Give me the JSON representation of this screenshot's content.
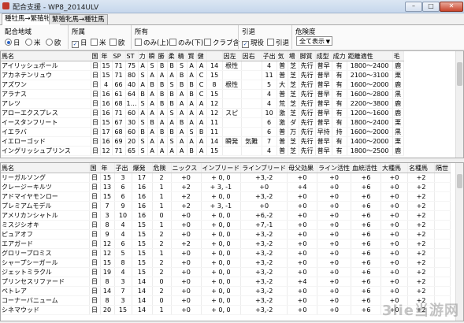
{
  "window": {
    "title": "配合支援 - WP8_2014ULV"
  },
  "tabs": [
    "種牡馬→繁殖牝馬",
    "繁殖牝馬→種牡馬"
  ],
  "filters": {
    "region": {
      "label": "配合地域",
      "options": [
        "日",
        "米",
        "欧"
      ],
      "selected": 0
    },
    "affiliation": {
      "label": "所属",
      "options": [
        "日",
        "米",
        "欧"
      ],
      "checked": [
        true,
        false,
        false
      ]
    },
    "owned": {
      "label": "所有",
      "options": [
        "のみ(上)",
        "のみ(下)",
        "クラブ含"
      ]
    },
    "retired": {
      "label": "引退",
      "options": [
        "現役",
        "引退"
      ],
      "checked": [
        true,
        false
      ]
    },
    "risk": {
      "label": "危険度",
      "value": "全て表示"
    }
  },
  "top_table": {
    "headers": [
      "馬名",
      "国",
      "年",
      "SP",
      "ST",
      "力",
      "瞬",
      "勝",
      "柔",
      "精",
      "賢",
      "健",
      "",
      "因左",
      "因右",
      "子出",
      "気",
      "場",
      "脚質",
      "成型",
      "成力",
      "距離適性",
      "毛"
    ],
    "rows": [
      [
        "アイリッシュボール",
        "日",
        "15",
        "71",
        "75",
        "A",
        "S",
        "B",
        "B",
        "S",
        "A",
        "A",
        "14",
        "根性",
        "",
        "4",
        "普",
        "芝",
        "先行",
        "普早",
        "有",
        "1800〜2400",
        "鹿"
      ],
      [
        "アカネテンリュウ",
        "日",
        "15",
        "71",
        "80",
        "S",
        "A",
        "A",
        "A",
        "B",
        "A",
        "C",
        "15",
        "",
        "",
        "11",
        "普",
        "芝",
        "先行",
        "普早",
        "有",
        "2100〜3100",
        "栗"
      ],
      [
        "アズワン",
        "日",
        "4",
        "66",
        "40",
        "A",
        "B",
        "B",
        "S",
        "B",
        "B",
        "C",
        "8",
        "根性",
        "",
        "5",
        "大",
        "芝",
        "先行",
        "普早",
        "有",
        "1600〜2000",
        "鹿"
      ],
      [
        "アラナス",
        "日",
        "16",
        "61",
        "64",
        "B",
        "A",
        "B",
        "B",
        "A",
        "B",
        "C",
        "15",
        "",
        "",
        "4",
        "普",
        "芝",
        "先行",
        "普早",
        "有",
        "1600〜2800",
        "黒"
      ],
      [
        "アレツ",
        "日",
        "16",
        "68",
        "1…",
        "S",
        "A",
        "B",
        "B",
        "A",
        "A",
        "A",
        "12",
        "",
        "",
        "4",
        "荒",
        "芝",
        "先行",
        "普早",
        "有",
        "2200〜3800",
        "鹿"
      ],
      [
        "アローエクスプレス",
        "日",
        "16",
        "71",
        "60",
        "A",
        "A",
        "A",
        "S",
        "A",
        "A",
        "A",
        "12",
        "スピ",
        "",
        "10",
        "激",
        "芝",
        "先行",
        "普早",
        "有",
        "1200〜1600",
        "鹿"
      ],
      [
        "イースタンフリート",
        "日",
        "15",
        "67",
        "30",
        "S",
        "B",
        "A",
        "A",
        "B",
        "A",
        "A",
        "11",
        "",
        "",
        "6",
        "激",
        "ダ",
        "先行",
        "普早",
        "有",
        "1800〜2400",
        "栗"
      ],
      [
        "イエラバ",
        "日",
        "17",
        "68",
        "60",
        "B",
        "A",
        "B",
        "B",
        "A",
        "S",
        "B",
        "11",
        "",
        "",
        "6",
        "普",
        "万",
        "先行",
        "早持",
        "持",
        "1600〜2000",
        "黒"
      ],
      [
        "イエローゴッド",
        "日",
        "16",
        "69",
        "20",
        "S",
        "A",
        "A",
        "S",
        "A",
        "A",
        "A",
        "14",
        "瞬発",
        "気難",
        "7",
        "普",
        "芝",
        "先行",
        "普早",
        "有",
        "1400〜2000",
        "栗"
      ],
      [
        "イングリッシュプリンス",
        "日",
        "12",
        "71",
        "65",
        "S",
        "A",
        "A",
        "A",
        "A",
        "B",
        "A",
        "15",
        "",
        "",
        "4",
        "普",
        "芝",
        "先行",
        "普早",
        "有",
        "1800〜2500",
        "鹿"
      ]
    ]
  },
  "bottom_table": {
    "headers": [
      "馬名",
      "国",
      "年",
      "子出",
      "爆発",
      "危険",
      "ニックス",
      "インブリード",
      "ラインブリード",
      "母父効果",
      "ライン活性",
      "血統活性",
      "大種馬",
      "名種馬",
      "隔世"
    ],
    "rows": [
      [
        "リーガルソング",
        "日",
        "15",
        "3",
        "17",
        "2",
        "+0",
        "+ 0, 0",
        "+3,-2",
        "+0",
        "+0",
        "+6",
        "+0",
        "+2",
        ""
      ],
      [
        "クレージーキルツ",
        "日",
        "13",
        "6",
        "16",
        "1",
        "+2",
        "+ 3, -1",
        "+0",
        "+4",
        "+0",
        "+6",
        "+0",
        "+2",
        ""
      ],
      [
        "アドマイヤモンロー",
        "日",
        "15",
        "6",
        "16",
        "1",
        "+2",
        "+ 0, 0",
        "+3,-2",
        "+0",
        "+0",
        "+6",
        "+0",
        "+2",
        ""
      ],
      [
        "プレミアムモデル",
        "日",
        "7",
        "9",
        "16",
        "1",
        "+2",
        "+ 3, -1",
        "+0",
        "+0",
        "+0",
        "+6",
        "+0",
        "+2",
        ""
      ],
      [
        "アメリカンシャトル",
        "日",
        "3",
        "10",
        "16",
        "0",
        "+0",
        "+ 0, 0",
        "+6,-2",
        "+0",
        "+0",
        "+6",
        "+0",
        "+2",
        ""
      ],
      [
        "ミスジシオキ",
        "日",
        "8",
        "4",
        "15",
        "1",
        "+0",
        "+ 0, 0",
        "+7,-1",
        "+0",
        "+0",
        "+6",
        "+0",
        "+2",
        ""
      ],
      [
        "ピュアオフ",
        "日",
        "9",
        "4",
        "15",
        "2",
        "+0",
        "+ 0, 0",
        "+3,-2",
        "+0",
        "+0",
        "+6",
        "+0",
        "+2",
        ""
      ],
      [
        "エアガード",
        "日",
        "12",
        "6",
        "15",
        "2",
        "+2",
        "+ 0, 0",
        "+3,-2",
        "+0",
        "+0",
        "+6",
        "+0",
        "+2",
        ""
      ],
      [
        "グロリープロミス",
        "日",
        "12",
        "5",
        "15",
        "1",
        "+0",
        "+ 0, 0",
        "+3,-2",
        "+0",
        "+0",
        "+6",
        "+0",
        "+2",
        ""
      ],
      [
        "シャープシーガール",
        "日",
        "15",
        "8",
        "15",
        "2",
        "+0",
        "+ 0, 0",
        "+3,-2",
        "+0",
        "+0",
        "+6",
        "+0",
        "+2",
        ""
      ],
      [
        "ジェットミラクル",
        "日",
        "19",
        "4",
        "15",
        "2",
        "+0",
        "+ 0, 0",
        "+3,-2",
        "+0",
        "+0",
        "+6",
        "+0",
        "+2",
        ""
      ],
      [
        "プリンセスリファード",
        "日",
        "8",
        "3",
        "14",
        "0",
        "+0",
        "+ 0, 0",
        "+3,-2",
        "+4",
        "+0",
        "+6",
        "+0",
        "+2",
        ""
      ],
      [
        "ペトレア",
        "日",
        "14",
        "7",
        "14",
        "2",
        "+0",
        "+ 0, 0",
        "+3,-2",
        "+0",
        "+0",
        "+6",
        "+0",
        "+2",
        ""
      ],
      [
        "コーナーバニューム",
        "日",
        "8",
        "3",
        "14",
        "0",
        "+0",
        "+ 0, 0",
        "+3,-2",
        "+0",
        "+0",
        "+6",
        "+0",
        "+2",
        ""
      ],
      [
        "シネマウッド",
        "日",
        "20",
        "15",
        "14",
        "1",
        "+0",
        "+ 0, 0",
        "+3,-2",
        "+0",
        "+0",
        "+6",
        "+0",
        "+2",
        ""
      ]
    ]
  },
  "watermark": "3lie当游网"
}
